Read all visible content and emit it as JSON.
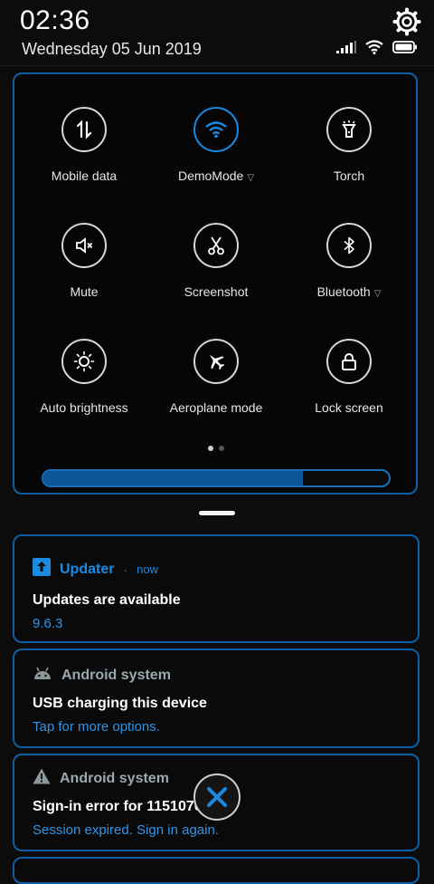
{
  "status": {
    "time": "02:36",
    "date": "Wednesday 05 Jun 2019"
  },
  "quick_settings": {
    "tiles": [
      {
        "label": "Mobile data",
        "icon": "mobile-data-icon",
        "active": false
      },
      {
        "label": "DemoMode",
        "icon": "wifi-icon",
        "active": true,
        "has_menu": true
      },
      {
        "label": "Torch",
        "icon": "torch-icon",
        "active": false
      },
      {
        "label": "Mute",
        "icon": "mute-icon",
        "active": false
      },
      {
        "label": "Screenshot",
        "icon": "scissors-icon",
        "active": false
      },
      {
        "label": "Bluetooth",
        "icon": "bluetooth-icon",
        "active": false,
        "has_menu": true
      },
      {
        "label": "Auto brightness",
        "icon": "brightness-icon",
        "active": false
      },
      {
        "label": "Aeroplane mode",
        "icon": "aeroplane-icon",
        "active": false
      },
      {
        "label": "Lock screen",
        "icon": "lock-icon",
        "active": false
      }
    ],
    "page_count": 2,
    "current_page": 1,
    "brightness_level": 0.75
  },
  "notifications": [
    {
      "app": "Updater",
      "meta": "now",
      "title": "Updates are available",
      "body": "9.6.3",
      "icon": "updater-icon"
    },
    {
      "app": "Android system",
      "title": "USB charging this device",
      "body": "Tap for more options.",
      "icon": "android-icon"
    },
    {
      "app": "Android system",
      "title": "Sign-in error for 1151070",
      "body": "Session expired. Sign in again.",
      "icon": "warning-icon"
    }
  ],
  "colors": {
    "accent": "#1b8ae3",
    "border": "#0f5fa6",
    "link": "#2f94e8"
  }
}
